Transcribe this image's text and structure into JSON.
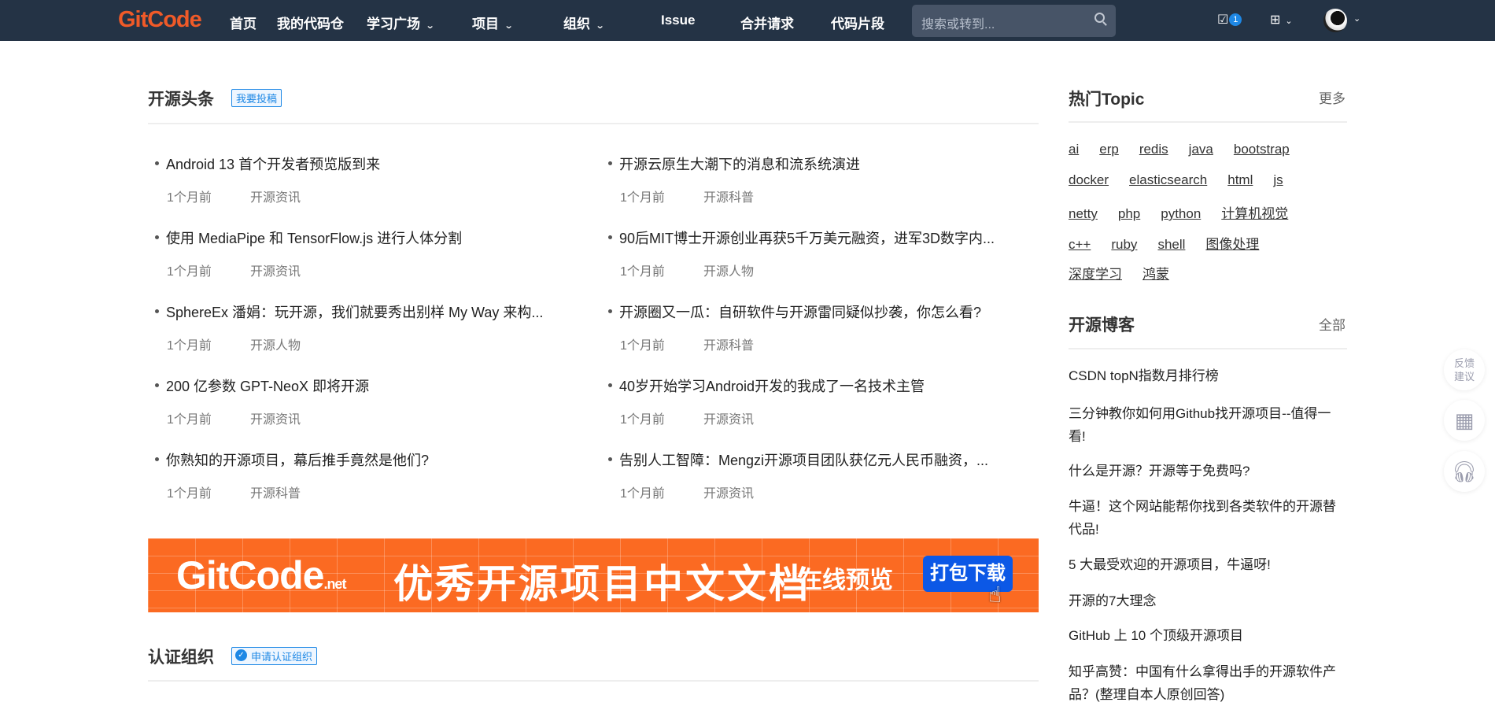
{
  "header": {
    "logo": "GitCode",
    "nav": [
      {
        "label": "首页"
      },
      {
        "label": "我的代码仓"
      },
      {
        "label": "学习广场",
        "dropdown": true
      },
      {
        "label": "项目",
        "dropdown": true
      },
      {
        "label": "组织",
        "dropdown": true
      },
      {
        "label": "Issue"
      },
      {
        "label": "合并请求"
      },
      {
        "label": "代码片段"
      }
    ],
    "search_placeholder": "搜索或转到...",
    "todo_count": "1"
  },
  "headlines": {
    "title": "开源头条",
    "submit": "我要投稿",
    "left": [
      {
        "title": "Android 13 首个开发者预览版到来",
        "time": "1个月前",
        "category": "开源资讯"
      },
      {
        "title": "使用 MediaPipe 和 TensorFlow.js 进行人体分割",
        "time": "1个月前",
        "category": "开源资讯"
      },
      {
        "title": "SphereEx 潘娟：玩开源，我们就要秀出别样 My Way 来构...",
        "time": "1个月前",
        "category": "开源人物"
      },
      {
        "title": "200 亿参数 GPT-NeoX 即将开源",
        "time": "1个月前",
        "category": "开源资讯"
      },
      {
        "title": "你熟知的开源项目，幕后推手竟然是他们?",
        "time": "1个月前",
        "category": "开源科普"
      }
    ],
    "right": [
      {
        "title": "开源云原生大潮下的消息和流系统演进",
        "time": "1个月前",
        "category": "开源科普"
      },
      {
        "title": "90后MIT博士开源创业再获5千万美元融资，进军3D数字内...",
        "time": "1个月前",
        "category": "开源人物"
      },
      {
        "title": "开源圈又一瓜：自研软件与开源雷同疑似抄袭，你怎么看?",
        "time": "1个月前",
        "category": "开源科普"
      },
      {
        "title": "40岁开始学习Android开发的我成了一名技术主管",
        "time": "1个月前",
        "category": "开源资讯"
      },
      {
        "title": "告别人工智障：Mengzi开源项目团队获亿元人民币融资，...",
        "time": "1个月前",
        "category": "开源资讯"
      }
    ]
  },
  "banner": {
    "logo": "GitCode",
    "logo_suffix": ".net",
    "text": "优秀开源项目中文文档",
    "preview": "在线预览",
    "download": "打包下载"
  },
  "orgs": {
    "title": "认证组织",
    "apply": "申请认证组织"
  },
  "topics": {
    "title": "热门Topic",
    "more": "更多",
    "rows": [
      [
        "ai",
        "erp",
        "redis",
        "java",
        "bootstrap"
      ],
      [
        "docker",
        "elasticsearch",
        "html",
        "js"
      ],
      [
        "netty",
        "php",
        "python",
        "计算机视觉"
      ],
      [
        "c++",
        "ruby",
        "shell",
        "图像处理"
      ],
      [
        "深度学习",
        "鸿蒙"
      ]
    ]
  },
  "blogs": {
    "title": "开源博客",
    "more": "全部",
    "items": [
      "CSDN topN指数月排行榜",
      "三分钟教你如何用Github找开源项目--值得一看!",
      "什么是开源？开源等于免费吗?",
      "牛逼！这个网站能帮你找到各类软件的开源替代品!",
      "5 大最受欢迎的开源项目，牛逼呀!",
      "开源的7大理念",
      "GitHub 上 10 个顶级开源项目",
      "知乎高赞：中国有什么拿得出手的开源软件产品？(整理自本人原创回答)"
    ]
  },
  "float": {
    "feedback": "反馈建议"
  }
}
